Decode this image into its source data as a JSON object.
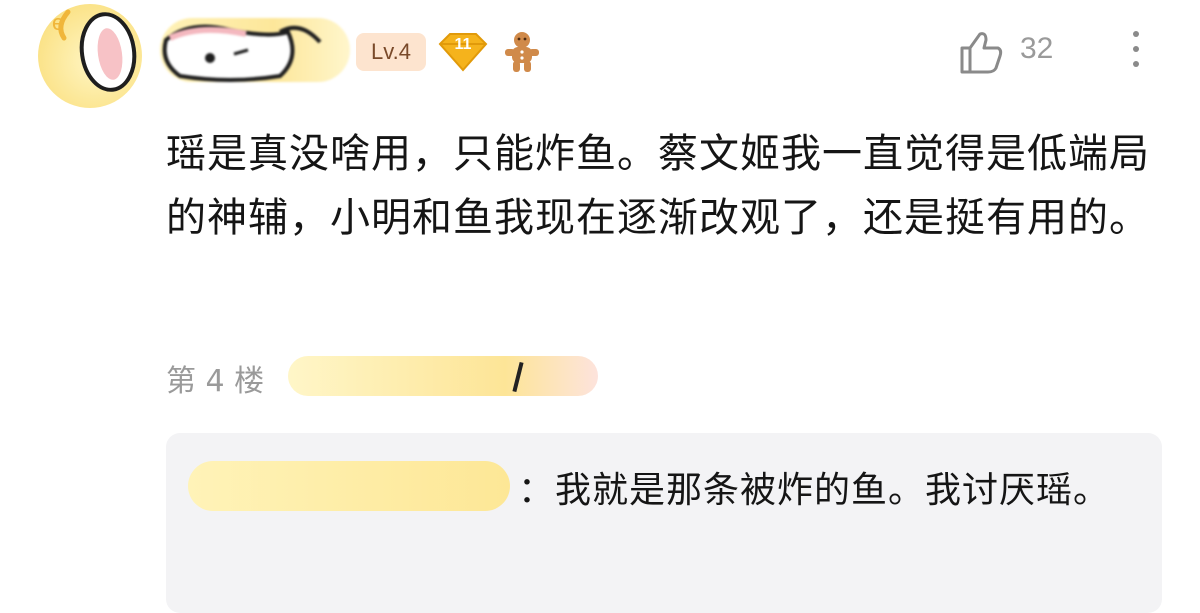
{
  "user": {
    "level_badge": "Lv.4",
    "fan_badge_number": "11",
    "avatar_icon": "bunny-avatar",
    "extra_badge_icon": "gingerbread-icon"
  },
  "actions": {
    "like_icon": "thumbs-up-icon",
    "like_count": "32",
    "more_icon": "vertical-dots-icon"
  },
  "comment": {
    "text": "瑶是真没啥用，只能炸鱼。蔡文姬我一直觉得是低端局的神辅，小明和鱼我现在逐渐改观了，还是挺有用的。",
    "floor_label": "第 4 楼"
  },
  "reply": {
    "text": "：我就是那条被炸的鱼。我讨厌瑶。"
  },
  "colors": {
    "level_badge_bg": "#fde4cf",
    "fan_badge": "#f5b31c",
    "muted_text": "#9a9a9a",
    "reply_bg": "#f3f3f5"
  }
}
